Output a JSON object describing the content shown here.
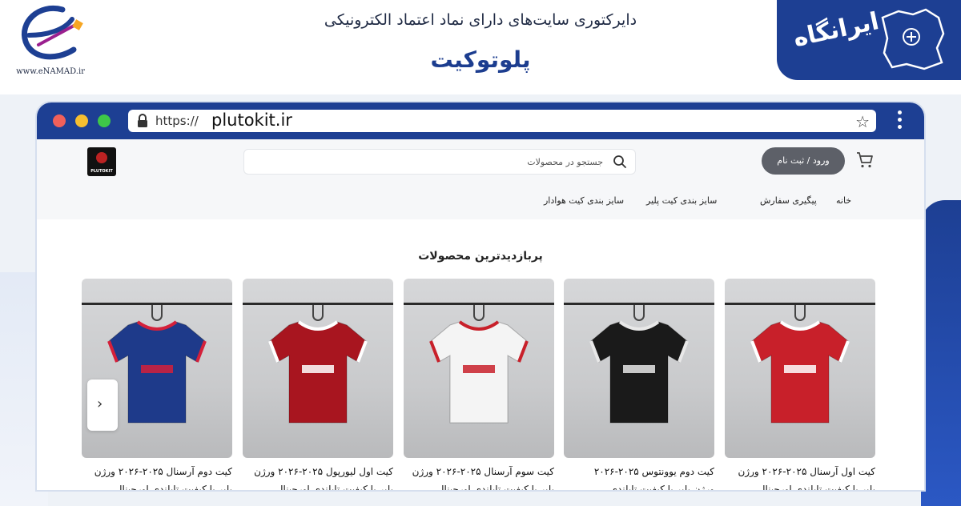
{
  "banner": {
    "enamad_url": "www.eNAMAD.ir",
    "title": "دایرکتوری سایت‌های دارای نماد اعتماد الکترونیکی",
    "subtitle": "پلوتوکیت",
    "brand": "ایرانگاه"
  },
  "browser": {
    "url_protocol": "https://",
    "url_host": "plutokit.ir"
  },
  "site": {
    "logo_text": "PLUTOKIT",
    "search_placeholder": "جستجو در محصولات",
    "login_label": "ورود / ثبت نام",
    "nav": [
      "خانه",
      "پیگیری سفارش",
      "سایز بندی کیت پلیر",
      "سایز بندی کیت هوادار"
    ],
    "section_title": "پربازدیدترین محصولات",
    "products": [
      {
        "name": "کیت اول آرسنال ۲۰۲۵-۲۰۲۶ ورژن",
        "sub": "پلیر با کیفیت تایلندی اورجینال",
        "color": "#c8202a",
        "trim": "#ffffff"
      },
      {
        "name": "کیت دوم یوونتوس ۲۰۲۵-۲۰۲۶",
        "sub": "ورژن پلیر با کیفیت تایلندی",
        "color": "#1a1a1a",
        "trim": "#e8e8e8"
      },
      {
        "name": "کیت سوم آرسنال ۲۰۲۵-۲۰۲۶ ورژن",
        "sub": "پلیر با کیفیت تایلندی اورجینال",
        "color": "#f4f4f4",
        "trim": "#c8202a"
      },
      {
        "name": "کیت اول لیورپول ۲۰۲۵-۲۰۲۶ ورژن",
        "sub": "پلیر با کیفیت تایلندی اورجینال",
        "color": "#a8151f",
        "trim": "#ffffff"
      },
      {
        "name": "کیت دوم آرسنال ۲۰۲۵-۲۰۲۶ ورژن",
        "sub": "پلیر با کیفیت تایلندی اورجینال",
        "color": "#1e3a8a",
        "trim": "#d4203a"
      }
    ]
  }
}
